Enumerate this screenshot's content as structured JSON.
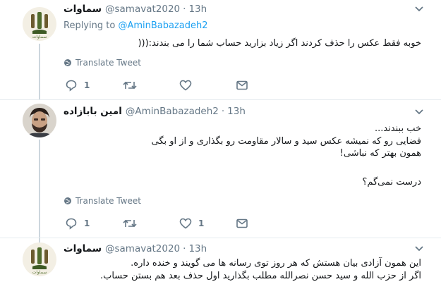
{
  "tweets": [
    {
      "name": "سماوات",
      "handle": "@samavat2020",
      "time": "13h",
      "replying_label": "Replying to",
      "replying_to": "@AminBabazadeh2",
      "lines": [
        "خوبه فقط عکس را حذف کردند اگر زیاد بزارید حساب شما را می بندند:((("
      ],
      "translate": "Translate Tweet",
      "actions": {
        "reply_count": "1",
        "retweet_count": "",
        "like_count": ""
      }
    },
    {
      "name": "امین بابازاده",
      "handle": "@AminBabazadeh2",
      "time": "13h",
      "lines": [
        "خب ببندند...",
        "فضایی رو که نمیشه عکس سید و سالار مقاومت رو بگذاری و از او بگی",
        "همون بهتر که نباشی!",
        "",
        "درست نمی‌گم؟"
      ],
      "translate": "Translate Tweet",
      "actions": {
        "reply_count": "1",
        "retweet_count": "",
        "like_count": "1"
      }
    },
    {
      "name": "سماوات",
      "handle": "@samavat2020",
      "time": "13h",
      "lines": [
        "این همون آزادی بیان هستش که هر روز توی رسانه ها می گویند و خنده داره.",
        "اگر از حزب الله و سید حسن نصرالله مطلب بگذارید اول حذف بعد هم بستن حساب."
      ]
    }
  ],
  "colors": {
    "accent": "#1da1f2",
    "muted": "#657786",
    "text": "#14171a",
    "divider": "#e6ecf0"
  },
  "icons": [
    "reply-icon",
    "retweet-icon",
    "like-icon",
    "dm-icon",
    "globe-icon",
    "chevron-down-icon"
  ]
}
